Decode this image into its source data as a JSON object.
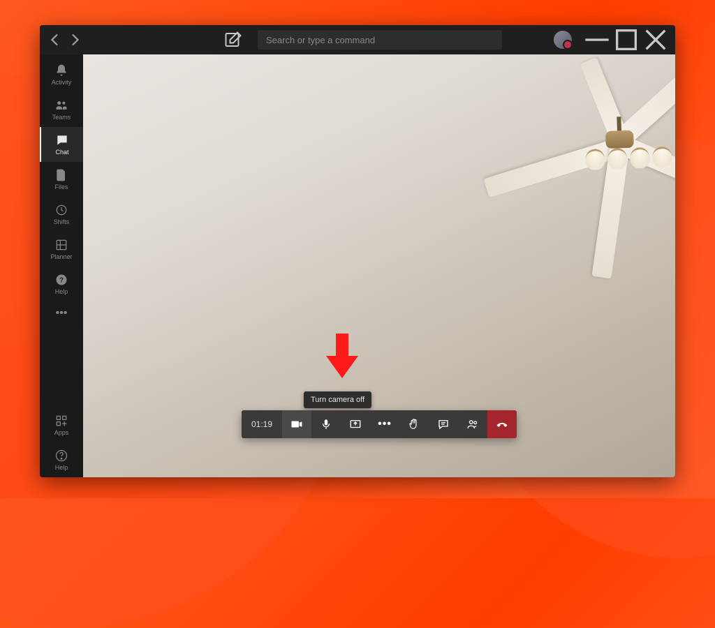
{
  "titlebar": {
    "search_placeholder": "Search or type a command"
  },
  "sidebar": {
    "items": [
      {
        "label": "Activity"
      },
      {
        "label": "Teams"
      },
      {
        "label": "Chat"
      },
      {
        "label": "Files"
      },
      {
        "label": "Shifts"
      },
      {
        "label": "Planner"
      },
      {
        "label": "Help"
      }
    ],
    "bottom": [
      {
        "label": "Apps"
      },
      {
        "label": "Help"
      }
    ]
  },
  "call": {
    "timer": "01:19",
    "tooltip_camera": "Turn camera off"
  },
  "colors": {
    "hangup": "#a4262c",
    "annotation": "#ff0000"
  }
}
